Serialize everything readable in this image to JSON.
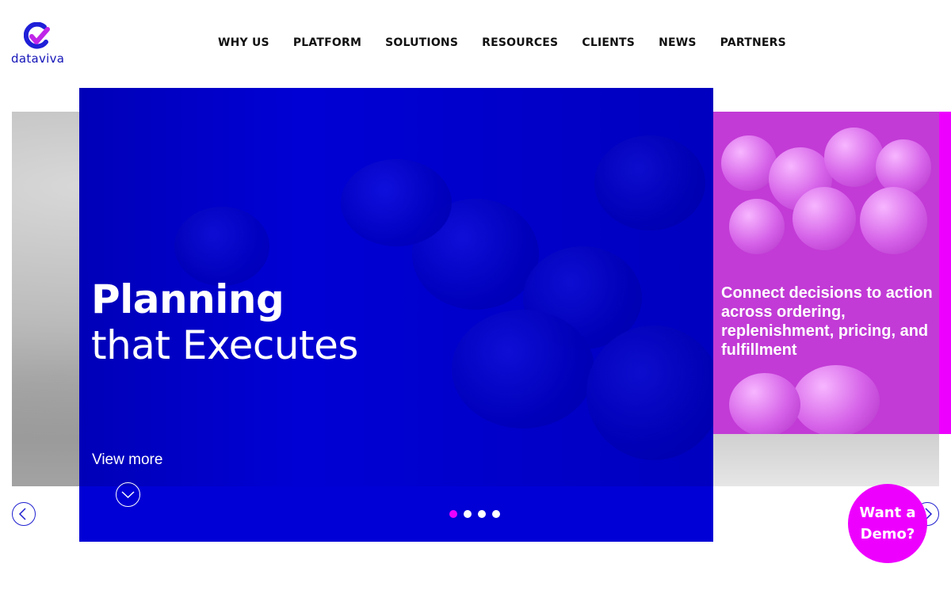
{
  "brand": {
    "name": "dataviva",
    "accent": "#ee00ff",
    "primary": "#0000d6"
  },
  "nav": {
    "items": [
      "WHY US",
      "PLATFORM",
      "SOLUTIONS",
      "RESOURCES",
      "CLIENTS",
      "NEWS",
      "PARTNERS"
    ]
  },
  "hero": {
    "title_bold": "Planning",
    "title_light": "that Executes",
    "view_more": "View more",
    "down_icon": "chevron-down-icon",
    "slides": 4,
    "active_slide": 1
  },
  "next_slide": {
    "text": "Connect decisions to action across ordering, replenishment, pricing, and fulfillment"
  },
  "carousel": {
    "prev_icon": "chevron-left-icon",
    "next_icon": "chevron-right-icon"
  },
  "cta": {
    "line1": "Want a",
    "line2": "Demo?"
  }
}
